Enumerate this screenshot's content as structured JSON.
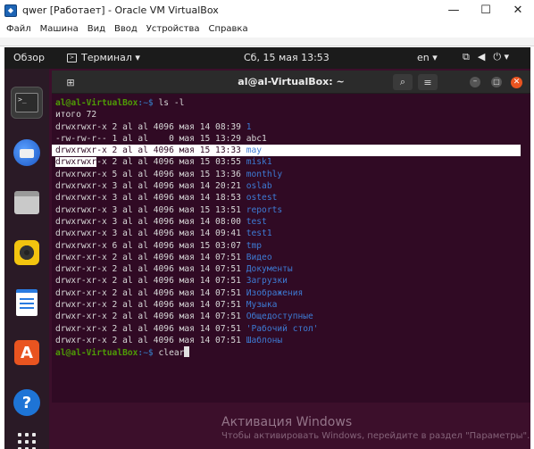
{
  "host_window": {
    "title": "qwer [Работает] - Oracle VM VirtualBox",
    "controls": {
      "minimize": "—",
      "maximize": "☐",
      "close": "✕"
    }
  },
  "vbox_menu": [
    "Файл",
    "Машина",
    "Вид",
    "Ввод",
    "Устройства",
    "Справка"
  ],
  "topbar": {
    "overview": "Обзор",
    "app_menu": "Терминал ▾",
    "clock": "Сб, 15 мая  13:53",
    "lang": "en ▾",
    "tray": [
      "⧉",
      "◀",
      "⏻ ▾"
    ]
  },
  "dock": {
    "items": [
      {
        "name": "terminal",
        "glyph": ">_"
      },
      {
        "name": "thunderbird"
      },
      {
        "name": "files"
      },
      {
        "name": "rhythmbox"
      },
      {
        "name": "libreoffice-writer"
      },
      {
        "name": "ubuntu-software",
        "glyph": "A"
      },
      {
        "name": "help",
        "glyph": "?"
      },
      {
        "name": "show-applications"
      }
    ]
  },
  "terminal": {
    "title": "al@al-VirtualBox: ~",
    "prompt_user": "al@al-VirtualBox",
    "prompt_sep": ":~$ ",
    "command1": "ls -l",
    "total": "итого 72",
    "entries": [
      {
        "meta": "drwxrwxr-x 2 al al 4096 мая 14 08:39 ",
        "name": "1",
        "type": "dir"
      },
      {
        "meta": "-rw-rw-r-- 1 al al    0 мая 15 13:29 ",
        "name": "abc1",
        "type": "file"
      },
      {
        "meta": "drwxrwxr-x 2 al al 4096 мая 15 13:33 ",
        "name": "may",
        "type": "dir",
        "state": "selected"
      },
      {
        "meta": "drwxrwxr-x 2 al al 4096 мая 15 03:55 ",
        "name": "misk1",
        "type": "dir",
        "state": "partial"
      },
      {
        "meta": "drwxrwxr-x 5 al al 4096 мая 15 13:36 ",
        "name": "monthly",
        "type": "dir"
      },
      {
        "meta": "drwxrwxr-x 3 al al 4096 мая 14 20:21 ",
        "name": "oslab",
        "type": "dir"
      },
      {
        "meta": "drwxrwxr-x 3 al al 4096 мая 14 18:53 ",
        "name": "ostest",
        "type": "dir"
      },
      {
        "meta": "drwxrwxr-x 3 al al 4096 мая 15 13:51 ",
        "name": "reports",
        "type": "dir"
      },
      {
        "meta": "drwxrwxr-x 3 al al 4096 мая 14 08:00 ",
        "name": "test",
        "type": "dir"
      },
      {
        "meta": "drwxrwxr-x 3 al al 4096 мая 14 09:41 ",
        "name": "test1",
        "type": "dir"
      },
      {
        "meta": "drwxrwxr-x 6 al al 4096 мая 15 03:07 ",
        "name": "tmp",
        "type": "dir"
      },
      {
        "meta": "drwxr-xr-x 2 al al 4096 мая 14 07:51 ",
        "name": "Видео",
        "type": "dir"
      },
      {
        "meta": "drwxr-xr-x 2 al al 4096 мая 14 07:51 ",
        "name": "Документы",
        "type": "dir"
      },
      {
        "meta": "drwxr-xr-x 2 al al 4096 мая 14 07:51 ",
        "name": "Загрузки",
        "type": "dir"
      },
      {
        "meta": "drwxr-xr-x 2 al al 4096 мая 14 07:51 ",
        "name": "Изображения",
        "type": "dir"
      },
      {
        "meta": "drwxr-xr-x 2 al al 4096 мая 14 07:51 ",
        "name": "Музыка",
        "type": "dir"
      },
      {
        "meta": "drwxr-xr-x 2 al al 4096 мая 14 07:51 ",
        "name": "Общедоступные",
        "type": "dir"
      },
      {
        "meta": "drwxr-xr-x 2 al al 4096 мая 14 07:51 ",
        "name": "'Рабочий стол'",
        "type": "dir"
      },
      {
        "meta": "drwxr-xr-x 2 al al 4096 мая 14 07:51 ",
        "name": "Шаблоны",
        "type": "dir"
      }
    ],
    "command2": "clear"
  },
  "watermark": {
    "title": "Активация Windows",
    "subtitle": "Чтобы активировать Windows, перейдите в раздел \"Параметры\"."
  },
  "colors": {
    "terminal_bg": "#300a24",
    "prompt_user": "#4e9a06",
    "prompt_path": "#3465a4",
    "dir_name": "#3d7bd4",
    "close_button": "#e95420"
  }
}
